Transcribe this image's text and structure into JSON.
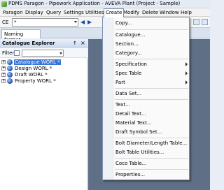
{
  "title": "PDMS Paragon - Pipework Application - AVEVA Plant (Project - Sample)",
  "menubar": [
    "Paragon",
    "Display",
    "Query",
    "Settings",
    "Utilities",
    "Create",
    "Modify",
    "Delete",
    "Window",
    "Help"
  ],
  "toolbar": {
    "ce_label": "CE",
    "ce_value": "*"
  },
  "tab": "Naming format",
  "explorer": {
    "title": "Catalogue Explorer",
    "pin": "↑",
    "close": "×",
    "filter_label": "Filter",
    "items": [
      {
        "label": "Catalogue WORL *",
        "selected": true
      },
      {
        "label": "Design WORL *"
      },
      {
        "label": "Draft WORL *"
      },
      {
        "label": "Property WORL *"
      }
    ]
  },
  "create_menu": [
    {
      "label": "Copy..."
    },
    {
      "sep": true
    },
    {
      "label": "Catalogue..."
    },
    {
      "label": "Section..."
    },
    {
      "label": "Category..."
    },
    {
      "sep": true
    },
    {
      "label": "Specification",
      "submenu": true
    },
    {
      "label": "Spec Table",
      "submenu": true
    },
    {
      "label": "Part",
      "submenu": true
    },
    {
      "sep": true
    },
    {
      "label": "Data Set..."
    },
    {
      "sep": true
    },
    {
      "label": "Text..."
    },
    {
      "label": "Detail Text..."
    },
    {
      "label": "Material Text..."
    },
    {
      "label": "Draft Symbol Set..."
    },
    {
      "sep": true
    },
    {
      "label": "Bolt Diameter/Length Table..."
    },
    {
      "label": "Bolt Table Utilities..."
    },
    {
      "sep": true
    },
    {
      "label": "Coco Table..."
    },
    {
      "sep": true
    },
    {
      "label": "Properties..."
    }
  ],
  "colors": {
    "selection": "#3875d7",
    "workspace": "#5f6f86"
  }
}
